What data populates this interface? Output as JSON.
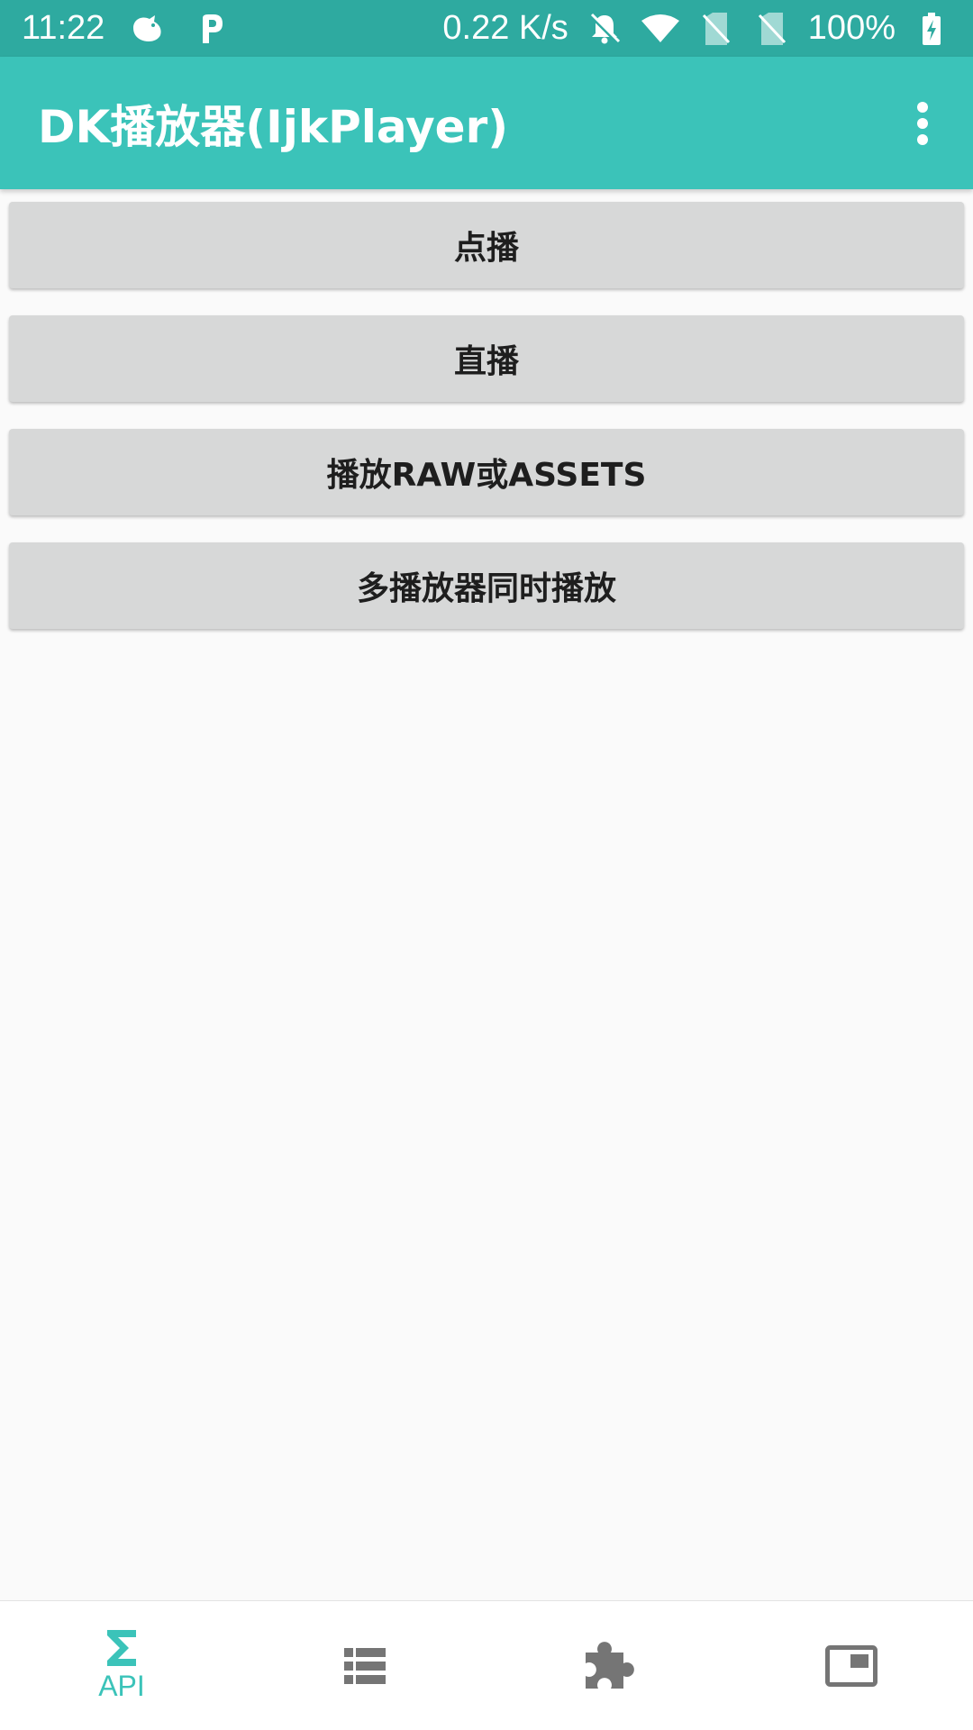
{
  "status_bar": {
    "time": "11:22",
    "network_speed": "0.22 K/s",
    "battery": "100%",
    "icons": [
      "bird-icon",
      "p-icon",
      "bell-off-icon",
      "wifi-icon",
      "no-sim-icon",
      "no-sim-icon",
      "battery-charging-icon"
    ]
  },
  "app_bar": {
    "title": "DK播放器(IjkPlayer)",
    "menu_icon": "more-vert-icon"
  },
  "buttons": [
    {
      "label": "点播"
    },
    {
      "label": "直播"
    },
    {
      "label": "播放RAW或ASSETS"
    },
    {
      "label": "多播放器同时播放"
    }
  ],
  "bottom_nav": {
    "items": [
      {
        "label": "API",
        "icon": "sigma-icon",
        "active": true
      },
      {
        "label": "",
        "icon": "list-icon",
        "active": false
      },
      {
        "label": "",
        "icon": "puzzle-icon",
        "active": false
      },
      {
        "label": "",
        "icon": "pip-icon",
        "active": false
      }
    ]
  },
  "colors": {
    "status_bar": "#2eaaa0",
    "app_bar": "#3bc3b9",
    "accent": "#3bc3b9",
    "button_bg": "#d7d8d8",
    "inactive_icon": "#757575"
  }
}
